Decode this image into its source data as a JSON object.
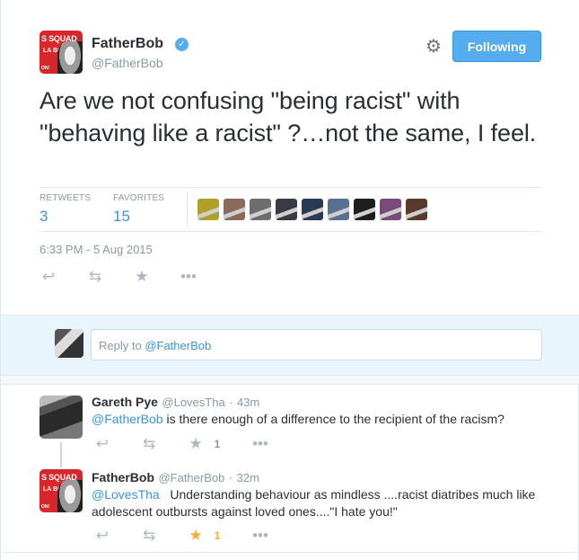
{
  "tweet": {
    "author_name": "FatherBob",
    "author_handle": "@FatherBob",
    "verified_icon": "verified-badge-icon",
    "avatar_text": [
      "S SQUAD",
      "LA BOB",
      "ON!"
    ],
    "follow_label": "Following",
    "text": "Are we not confusing \"being racist\" with \"behaving like a racist\" ?…not the same, I feel.",
    "stats": {
      "retweets_label": "RETWEETS",
      "retweets": "3",
      "favorites_label": "FAVORITES",
      "favorites": "15"
    },
    "favoriter_colors": [
      "#b0a02a",
      "#8a6a5a",
      "#6d6d6d",
      "#3a3a45",
      "#2a3a55",
      "#5a7090",
      "#1e1e1e",
      "#7a4a7a",
      "#5a3a2a"
    ],
    "timestamp": "6:33 PM - 5 Aug 2015",
    "actions": [
      "reply-icon",
      "retweet-icon",
      "favorite-icon",
      "more-icon"
    ]
  },
  "reply_box": {
    "prefix": "Reply to ",
    "mention": "@FatherBob"
  },
  "replies": [
    {
      "name": "Gareth Pye",
      "handle": "@LovesTha",
      "time": "43m",
      "mention": "@FatherBob",
      "text": " is there enough of a difference to the recipient of the racism?",
      "fav_count": "1",
      "favorited": false
    },
    {
      "name": "FatherBob",
      "handle": "@FatherBob",
      "time": "32m",
      "mention": "@LovesTha",
      "text": "   Understanding behaviour as mindless ....racist diatribes much like adolescent outbursts against loved ones....\"I hate you!\"",
      "fav_count": "1",
      "favorited": true
    }
  ],
  "colors": {
    "accent": "#55acee",
    "link": "#3b94d9",
    "muted": "#8899a6",
    "favorite_active": "#ffac33"
  }
}
